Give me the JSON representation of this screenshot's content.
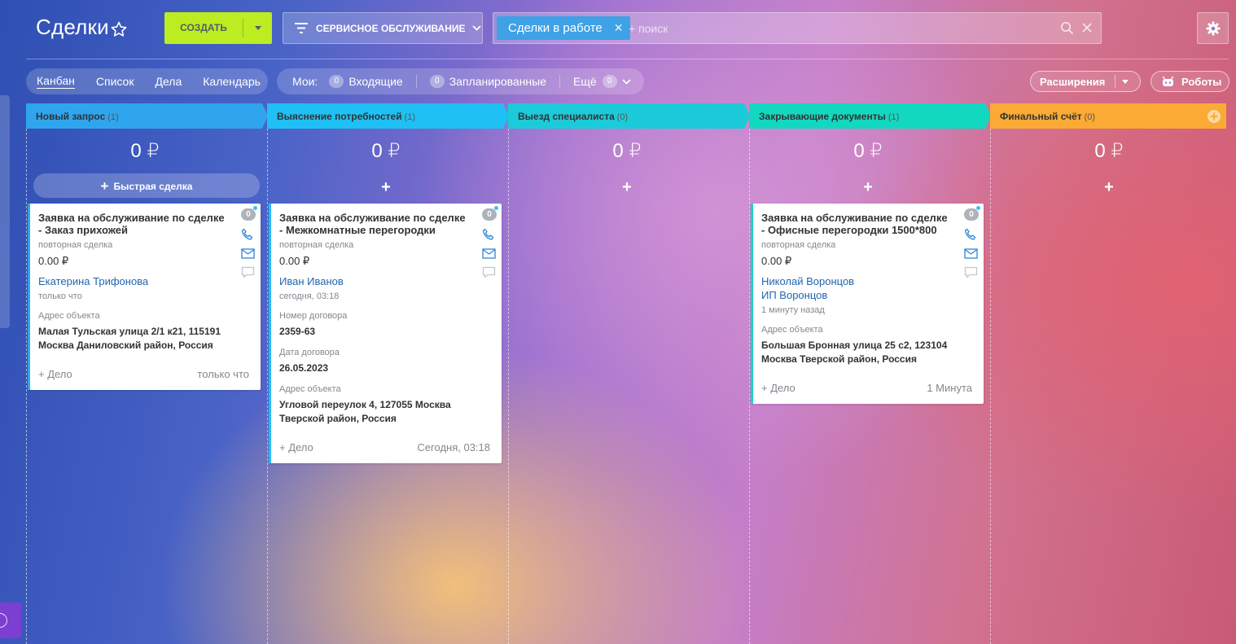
{
  "header": {
    "title": "Сделки",
    "create_label": "СОЗДАТЬ",
    "filter_label": "СЕРВИСНОЕ ОБСЛУЖИВАНИЕ",
    "search_tag": "Сделки в работе",
    "search_placeholder": "+ поиск"
  },
  "views": {
    "items": [
      "Канбан",
      "Список",
      "Дела",
      "Календарь"
    ],
    "active": "Канбан"
  },
  "counters": {
    "label": "Мои:",
    "incoming_count": "0",
    "incoming_label": "Входящие",
    "planned_count": "0",
    "planned_label": "Запланированные",
    "more_label": "Ещё",
    "more_count": "0"
  },
  "toolbar": {
    "extensions_label": "Расширения",
    "robots_label": "Роботы"
  },
  "columns": [
    {
      "name": "Новый запрос",
      "count": "(1)",
      "sum": "0 ₽",
      "color": "#2fa5ee",
      "quick_label": "Быстрая сделка"
    },
    {
      "name": "Выяснение потребностей",
      "count": "(1)",
      "sum": "0 ₽",
      "color": "#1fc0f4"
    },
    {
      "name": "Выезд специалиста",
      "count": "(0)",
      "sum": "0 ₽",
      "color": "#1ccbd9"
    },
    {
      "name": "Закрывающие документы",
      "count": "(1)",
      "sum": "0 ₽",
      "color": "#13d8c0"
    },
    {
      "name": "Финальный счёт",
      "count": "(0)",
      "sum": "0 ₽",
      "color": "#fbaa35"
    }
  ],
  "plus_label": "+",
  "cards": {
    "c1": {
      "title": "Заявка на обслуживание по сделке - Заказ прихожей",
      "sub": "повторная сделка",
      "amount": "0.00 ₽",
      "contact1": "Екатерина Трифонова",
      "time": "только что",
      "field1_label": "Адрес объекта",
      "field1_line1": "Малая Тульская улица 2/1 к21, 115191",
      "field1_line2": "Москва Даниловский район, Россия",
      "add_label": "+ Дело",
      "foot_time": "только что",
      "activity_count": "0",
      "accent": "#2fa5ee"
    },
    "c2": {
      "title": "Заявка на обслуживание по сделке - Межкомнатные перегородки",
      "sub": "повторная сделка",
      "amount": "0.00 ₽",
      "contact1": "Иван Иванов",
      "time": "сегодня, 03:18",
      "field1_label": "Номер договора",
      "field1_value": "2359-63",
      "field2_label": "Дата договора",
      "field2_value": "26.05.2023",
      "field3_label": "Адрес объекта",
      "field3_line1": "Угловой переулок 4, 127055 Москва",
      "field3_line2": "Тверской район, Россия",
      "add_label": "+ Дело",
      "foot_time": "Сегодня, 03:18",
      "activity_count": "0",
      "accent": "#1fc0f4"
    },
    "c4": {
      "title": "Заявка на обслуживание по сделке - Офисные перегородки 1500*800",
      "sub": "повторная сделка",
      "amount": "0.00 ₽",
      "contact1": "Николай Воронцов",
      "contact2": "ИП Воронцов",
      "time": "1 минуту назад",
      "field1_label": "Адрес объекта",
      "field1_line1": "Большая Бронная улица 25 с2, 123104",
      "field1_line2": "Москва Тверской район, Россия",
      "add_label": "+ Дело",
      "foot_time": "1 Минута",
      "activity_count": "0",
      "accent": "#13d8c0"
    }
  }
}
